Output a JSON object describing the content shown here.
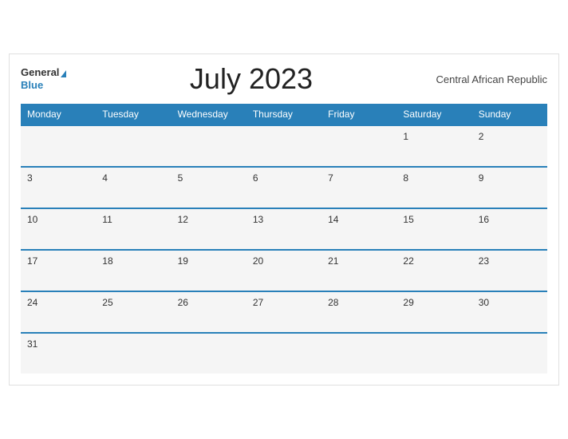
{
  "header": {
    "logo_general": "General",
    "logo_blue": "Blue",
    "title": "July 2023",
    "country": "Central African Republic"
  },
  "days": [
    "Monday",
    "Tuesday",
    "Wednesday",
    "Thursday",
    "Friday",
    "Saturday",
    "Sunday"
  ],
  "weeks": [
    [
      "",
      "",
      "",
      "",
      "",
      "1",
      "2"
    ],
    [
      "3",
      "4",
      "5",
      "6",
      "7",
      "8",
      "9"
    ],
    [
      "10",
      "11",
      "12",
      "13",
      "14",
      "15",
      "16"
    ],
    [
      "17",
      "18",
      "19",
      "20",
      "21",
      "22",
      "23"
    ],
    [
      "24",
      "25",
      "26",
      "27",
      "28",
      "29",
      "30"
    ],
    [
      "31",
      "",
      "",
      "",
      "",
      "",
      ""
    ]
  ]
}
